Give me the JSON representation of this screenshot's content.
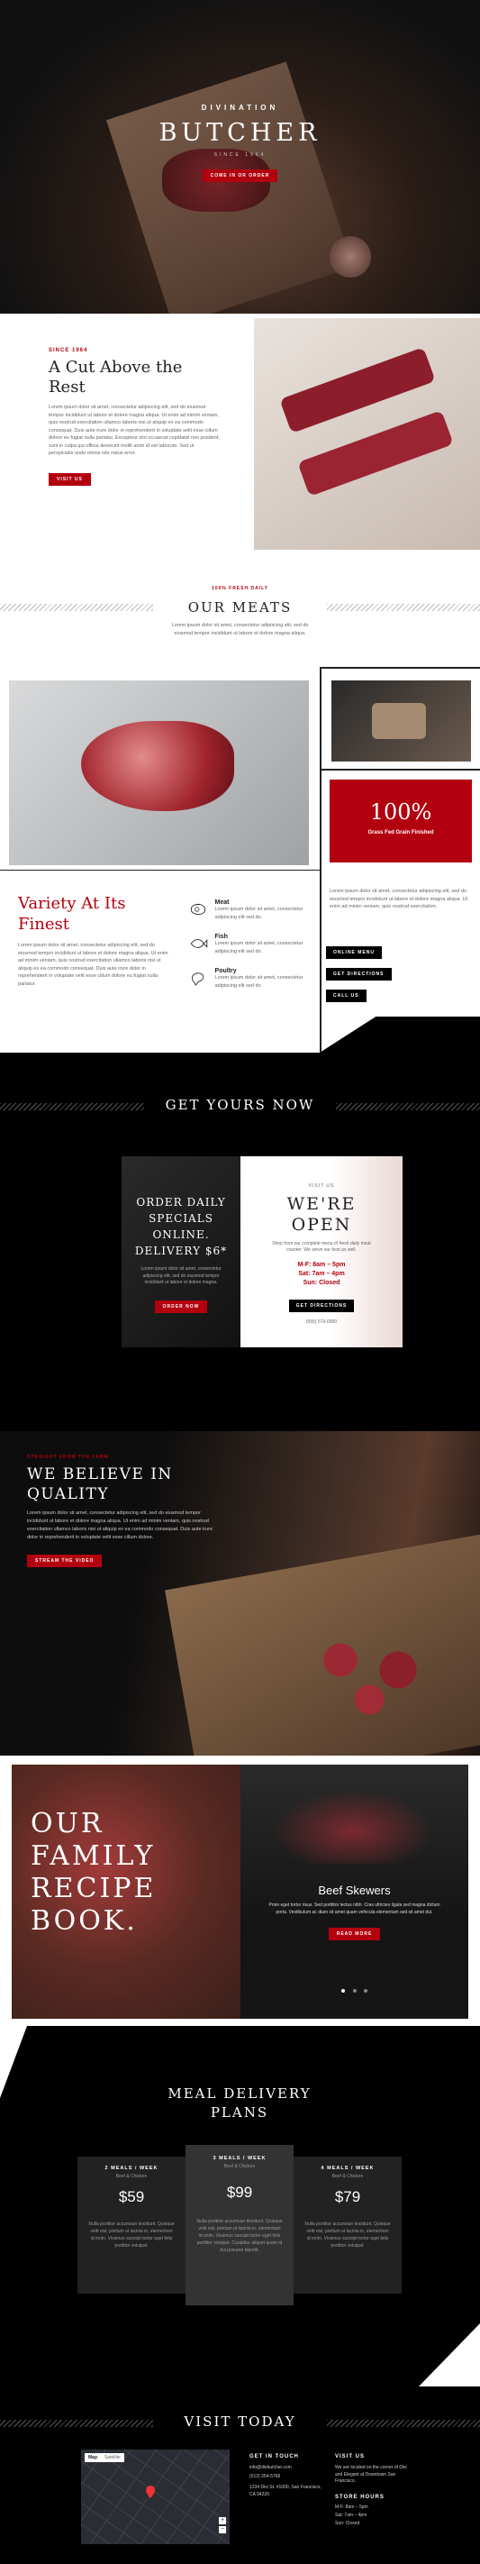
{
  "hero": {
    "eyebrow": "DIVINATION",
    "title": "BUTCHER",
    "since": "SINCE 1964",
    "cta": "come in or order"
  },
  "about": {
    "tag": "SINCE 1964",
    "title": "A Cut Above the Rest",
    "body": "Lorem ipsum dolor sit amet, consectetur adipiscing elit, sed do eiusmod tempor incididunt ut labore et dolore magna aliqua. Ut enim ad minim veniam, quis nostrud exercitation ullamco laboris nisi ut aliquip ex ea commodo consequat. Duis aute irure dolor in reprehenderit in voluptate velit esse cillum dolore eu fugiat nulla pariatur. Excepteur sint occaecat cupidatat non proident, sunt in culpa qui officia deserunt mollit anim id est laborum. Sed ut perspiciatis unde omnis iste natus error.",
    "cta": "visit us"
  },
  "meats": {
    "tag": "100% FRESH DAILY",
    "title": "OUR MEATS",
    "body": "Lorem ipsum dolor sit amet, consectetur adipiscing elit, sed do eiusmod tempor incididunt ut labore et dolore magna aliqua.",
    "stat_value": "100%",
    "stat_label": "Grass Fed Grain Finished",
    "side_text": "Lorem ipsum dolor sit amet, consectetur adipiscing elit, sed do eiusmod tempor incididunt ut labore et dolore magna aliqua. Ut enim ad minim veniam, quis nostrud exercitation.",
    "buttons": [
      "online menu",
      "get directions",
      "call us"
    ]
  },
  "variety": {
    "title": "Variety At Its Finest",
    "body": "Lorem ipsum dolor sit amet, consectetur adipiscing elit, sed do eiusmod tempor incididunt ut labore et dolore magna aliqua. Ut enim ad minim veniam, quis nostrud exercitation ullamco laboris nisi ut aliquip ex ea commodo consequat. Duis aute irure dolor in reprehenderit in voluptate velit esse cillum dolore eu fugiat nulla pariatur.",
    "items": [
      {
        "name": "Meat",
        "desc": "Lorem ipsum dolor sit amet, consectetur adipiscing elit sed do."
      },
      {
        "name": "Fish",
        "desc": "Lorem ipsum dolor sit amet, consectetur adipiscing elit sed do."
      },
      {
        "name": "Poultry",
        "desc": "Lorem ipsum dolor sit amet, consectetur adipiscing elit sed do."
      }
    ]
  },
  "order": {
    "title": "GET YOURS NOW",
    "card_title": "ORDER DAILY SPECIALS ONLINE. DELIVERY $6*",
    "card_body": "Lorem ipsum dolor sit amet, consectetur adipiscing elit, sed do eiusmod tempor incididunt ut labore et dolore magna.",
    "card_cta": "order now",
    "open_tag": "VISIT US",
    "open_title": "WE'RE OPEN",
    "open_body": "Shop from our complete menu of fresh daily meat counter. We serve our best as well.",
    "hours": [
      "M-F: 8am – 5pm",
      "Sat: 7am – 4pm",
      "Sun: Closed"
    ],
    "open_cta": "get directions",
    "phone": "(555) 573-0000"
  },
  "quality": {
    "tag": "STRAIGHT FROM THE FARM",
    "title": "WE BELIEVE IN QUALITY",
    "body": "Lorem ipsum dolor sit amet, consectetur adipiscing elit, sed do eiusmod tempor incididunt ut labore et dolore magna aliqua. Ut enim ad minim veniam, quis nostrud exercitation ullamco laboris nisi ut aliquip ex ea commodo consequat. Duis aute irure dolor in reprehenderit in voluptate velit esse cillum dolore.",
    "cta": "stream the video"
  },
  "recipe": {
    "title": "OUR FAMILY RECIPE BOOK.",
    "slide_title": "Beef Skewers",
    "slide_body": "Proin eget tortor risus. Sed porttitor lectus nibh. Cras ultricies ligula sed magna dictum porta. Vestibulum ac diam sit amet quam vehicula elementum sed sit amet dui.",
    "slide_cta": "read more"
  },
  "plans": {
    "title": "MEAL DELIVERY PLANS",
    "cards": [
      {
        "label": "2 MEALS / WEEK",
        "sub": "Beef & Chicken",
        "price": "$59",
        "body": "Nulla porttitor accumsan tincidunt. Quisque velit nisi, pretium ut lacinia in, elementum id enim. Vivamus suscipit tortor eget felis porttitor volutpat."
      },
      {
        "label": "3 MEALS / WEEK",
        "sub": "Beef & Chicken",
        "price": "$99",
        "body": "Nulla porttitor accumsan tincidunt. Quisque velit nisi, pretium ut lacinia in, elementum id enim. Vivamus suscipit tortor eget felis porttitor volutpat. Curabitur aliquet quam id dui posuere blandit."
      },
      {
        "label": "4 MEALS / WEEK",
        "sub": "Beef & Chicken",
        "price": "$79",
        "body": "Nulla porttitor accumsan tincidunt. Quisque velit nisi, pretium ut lacinia in, elementum id enim. Vivamus suscipit tortor eget felis porttitor volutpat."
      }
    ]
  },
  "visit": {
    "title": "VISIT TODAY",
    "map_tabs": [
      "Map",
      "Satellite"
    ],
    "contact_title": "GET IN TOUCH",
    "email": "info@divbutcher.com",
    "phone": "(512) 354-5768",
    "address": "1234 Divi St. #1000, San Francisco, CA 94220",
    "visit_title": "VISIT US",
    "visit_body": "We are located on the corner of Divi and Elegant at Downtown San Francisco.",
    "hours_title": "STORE HOURS",
    "hours": [
      "M-F: 8am – 5pm",
      "Sat: 7am – 4pm",
      "Sun: Closed"
    ]
  }
}
